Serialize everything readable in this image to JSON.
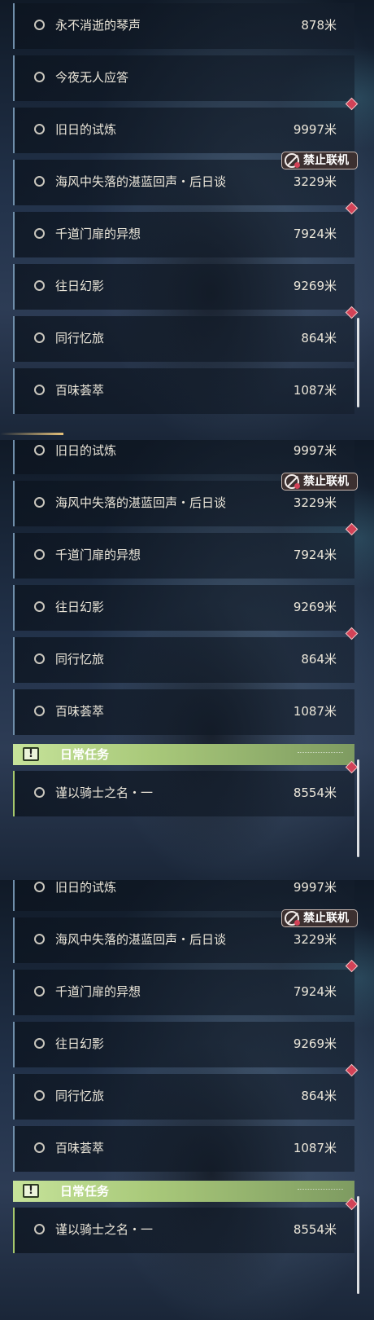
{
  "panels": [
    {
      "rows": [
        {
          "name": "永不消逝的琴声",
          "distance": "878米",
          "marker": "none"
        },
        {
          "name": "今夜无人应答",
          "distance": "",
          "marker": "none"
        },
        {
          "name": "旧日的试炼",
          "distance": "9997米",
          "marker": "diamond"
        },
        {
          "name": "海风中失落的湛蓝回声・后日谈",
          "distance": "3229米",
          "marker": "badge"
        },
        {
          "name": "千道门扉的异想",
          "distance": "7924米",
          "marker": "diamond"
        },
        {
          "name": "往日幻影",
          "distance": "9269米",
          "marker": "none"
        },
        {
          "name": "同行忆旅",
          "distance": "864米",
          "marker": "diamond"
        },
        {
          "name": "百味荟萃",
          "distance": "1087米",
          "marker": "none"
        }
      ]
    },
    {
      "rows": [
        {
          "name": "旧日的试炼",
          "distance": "9997米",
          "marker": "diamond"
        },
        {
          "name": "海风中失落的湛蓝回声・后日谈",
          "distance": "3229米",
          "marker": "badge"
        },
        {
          "name": "千道门扉的异想",
          "distance": "7924米",
          "marker": "diamond"
        },
        {
          "name": "往日幻影",
          "distance": "9269米",
          "marker": "none"
        },
        {
          "name": "同行忆旅",
          "distance": "864米",
          "marker": "diamond"
        },
        {
          "name": "百味荟萃",
          "distance": "1087米",
          "marker": "none"
        }
      ],
      "section_title": "日常任务",
      "daily_row": {
        "name": "谨以骑士之名・一",
        "distance": "8554米",
        "marker": "diamond"
      }
    },
    {
      "rows": [
        {
          "name": "旧日的试炼",
          "distance": "9997米",
          "marker": "none"
        },
        {
          "name": "海风中失落的湛蓝回声・后日谈",
          "distance": "3229米",
          "marker": "badge"
        },
        {
          "name": "千道门扉的异想",
          "distance": "7924米",
          "marker": "diamond"
        },
        {
          "name": "往日幻影",
          "distance": "9269米",
          "marker": "none"
        },
        {
          "name": "同行忆旅",
          "distance": "864米",
          "marker": "diamond"
        },
        {
          "name": "百味荟萃",
          "distance": "1087米",
          "marker": "none"
        }
      ],
      "section_title": "日常任务",
      "daily_row": {
        "name": "谨以骑士之名・一",
        "distance": "8554米",
        "marker": "diamond"
      }
    }
  ],
  "badge_text": "禁止联机",
  "header_icon": "!",
  "icons": {
    "row": "circle-icon",
    "badge": "no-multiplayer-icon",
    "marker": "diamond-marker-icon",
    "section": "exclamation-icon"
  },
  "colors": {
    "diamond": "#d24257",
    "daily_accent": "#a6c86c",
    "row_border": "#6f8eaa"
  }
}
